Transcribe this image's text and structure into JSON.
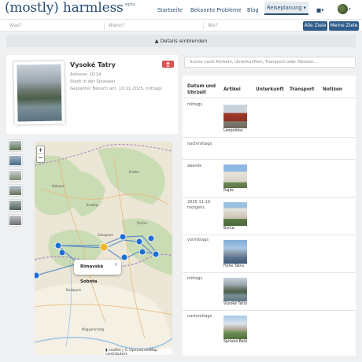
{
  "header": {
    "logo": "(mostly) harmless",
    "logo_badge": "alpha",
    "nav": [
      "Startseite",
      "Bekannte Probleme",
      "Blog"
    ],
    "active_nav": "Reiseplanung ▾",
    "chat_icon": "chat-icon",
    "chat_caret": "▾",
    "avatar_caret": "▾"
  },
  "filter": {
    "was_placeholder": "Was?",
    "wann_placeholder": "Wann?",
    "wo_placeholder": "Wo?",
    "all_button": "Alle Ziele",
    "mine_button": "Meine Ziele"
  },
  "details_toggle": "▲  Details einblenden",
  "place": {
    "name": "Vysoké Tatry",
    "address": "Adresse: Q214",
    "type": "Stadt in der Slowakei",
    "planned": "Geplanter Besuch am: 10.11.2025, mittags",
    "delete_icon": "trash-icon"
  },
  "map": {
    "zoom_in": "+",
    "zoom_out": "−",
    "popup": "Rimavská Sobota",
    "popup_close": "×",
    "attribution": "▮ Leaflet | © OpenStreetMap contributors"
  },
  "search_placeholder": "Suche nach Artikeln, Unterkünften, Transport oder Notizen...",
  "table": {
    "headers": [
      "Datum und Uhrzeit",
      "Artikel",
      "Unterkunft",
      "Transport",
      "Notizen"
    ],
    "rows": [
      {
        "time": "mittags",
        "article": "Leopoldov"
      },
      {
        "time": "nachmittags",
        "article": ""
      },
      {
        "time": "abends",
        "article": "Rajec"
      },
      {
        "time": "2025-11-10 morgens",
        "article": "Bytča"
      },
      {
        "time": "vormittags",
        "article": "Hohe Tatra"
      },
      {
        "time": "mittags",
        "article": "Vysoké Tatry"
      },
      {
        "time": "nachmittags",
        "article": "Spišská Belá"
      }
    ]
  },
  "colors": {
    "brand": "#2a4f73",
    "button": "#2f5c8a",
    "danger": "#d9534f",
    "marker": "#1f6fd1"
  }
}
